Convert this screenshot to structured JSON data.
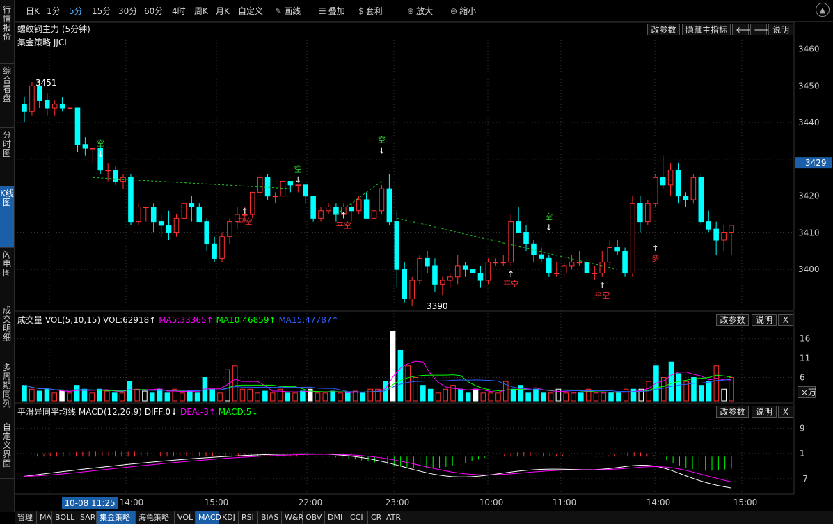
{
  "toolbar": {
    "items": [
      "日K",
      "1分",
      "5分",
      "15分",
      "30分",
      "60分",
      "4时",
      "周K",
      "月K",
      "自定义"
    ],
    "active_index": 2,
    "tools": [
      {
        "label": "画线",
        "icon": "pencil-icon"
      },
      {
        "label": "叠加",
        "icon": "stack-icon"
      },
      {
        "label": "套利",
        "icon": "money-bag-icon"
      },
      {
        "label": "放大",
        "icon": "zoom-in-icon"
      },
      {
        "label": "缩小",
        "icon": "zoom-out-icon"
      }
    ]
  },
  "sidebar": {
    "tabs": [
      "行情报价",
      "综合看盘",
      "分时图",
      "K线图",
      "闪电图",
      "成交明细",
      "多周期同列",
      "自定义界面"
    ],
    "active_index": 3
  },
  "main_panel": {
    "title": "螺纹钢主力 (5分钟)",
    "strategy": "集金策略 JJCL",
    "buttons": [
      "改参数",
      "隐藏主指标",
      "说明"
    ],
    "current_price": "3429",
    "y_ticks": [
      "3460",
      "3450",
      "3440",
      "3420",
      "3410",
      "3400"
    ],
    "high_label": "3451",
    "low_label": "3390",
    "signals": [
      {
        "text": "空",
        "color": "#33dd33"
      },
      {
        "text": "平空",
        "color": "#ff3333"
      },
      {
        "text": "空",
        "color": "#33dd33"
      },
      {
        "text": "平空",
        "color": "#ff3333"
      },
      {
        "text": "空",
        "color": "#33dd33"
      },
      {
        "text": "平空",
        "color": "#ff3333"
      },
      {
        "text": "空",
        "color": "#33dd33"
      },
      {
        "text": "平空",
        "color": "#ff3333"
      },
      {
        "text": "多",
        "color": "#ff3333"
      }
    ]
  },
  "volume_panel": {
    "label": "成交量",
    "formula": "VOL(5,10,15)",
    "vol": "VOL:62918↑",
    "ma5": "MA5:33365↑",
    "ma10": "MA10:46859↑",
    "ma15": "MA15:47787↑",
    "buttons": [
      "改参数",
      "说明",
      "X"
    ],
    "y_ticks": [
      "16",
      "11",
      "6"
    ],
    "unit": "×万"
  },
  "macd_panel": {
    "label": "平滑异同平均线",
    "formula": "MACD(12,26,9)",
    "diff": "DIFF:0↓",
    "dea": "DEA:-3↑",
    "macd": "MACD:5↓",
    "buttons": [
      "改参数",
      "说明",
      "X"
    ],
    "y_ticks": [
      "9",
      "1",
      "-7"
    ]
  },
  "time_axis": {
    "cursor_label": "10-08 11:25",
    "labels": [
      "14:00",
      "15:00",
      "22:00",
      "23:00",
      "10:00",
      "11:00",
      "14:00",
      "15:00"
    ]
  },
  "bottom_tabs": {
    "items": [
      "管理",
      "MA",
      "BOLL",
      "SAR",
      "集金策略",
      "海龟策略",
      "VOL",
      "MACD",
      "KDJ",
      "RSI",
      "BIAS",
      "W&R",
      "OBV",
      "DMI",
      "CCI",
      "CR",
      "ATR"
    ],
    "active_indices": [
      4,
      7
    ]
  },
  "colors": {
    "up": "#ff3232",
    "down": "#00ffff",
    "ma5": "#ff00ff",
    "ma10": "#00ff00",
    "ma15": "#3060ff",
    "accent": "#1a5fa8"
  }
}
